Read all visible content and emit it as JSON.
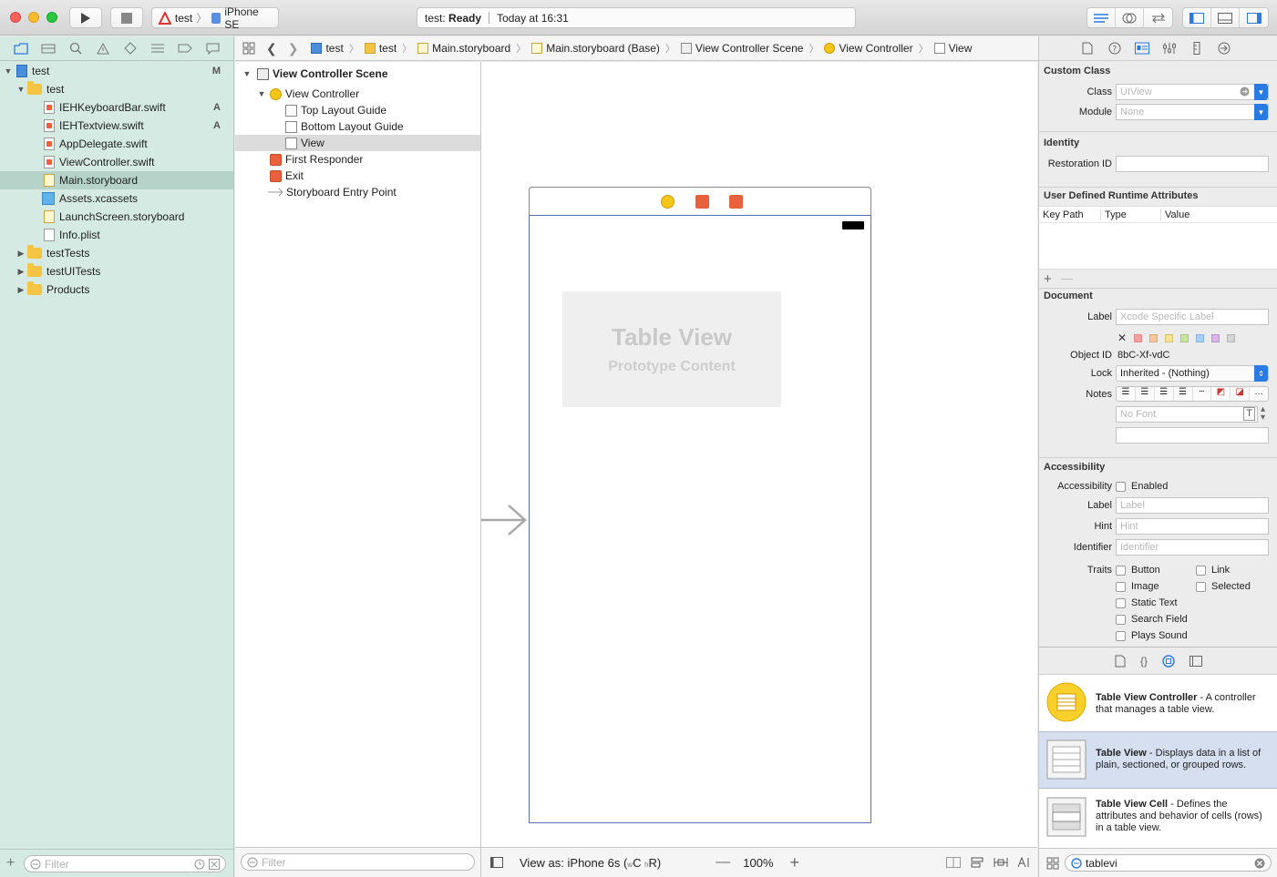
{
  "toolbar": {
    "scheme_target": "test",
    "scheme_device": "iPhone SE",
    "status_project": "test:",
    "status_state": "Ready",
    "status_time": "Today at 16:31"
  },
  "navigator": {
    "items": [
      {
        "label": "test",
        "badge": "M"
      },
      {
        "label": "test",
        "badge": ""
      },
      {
        "label": "IEHKeyboardBar.swift",
        "badge": "A"
      },
      {
        "label": "IEHTextview.swift",
        "badge": "A"
      },
      {
        "label": "AppDelegate.swift",
        "badge": ""
      },
      {
        "label": "ViewController.swift",
        "badge": ""
      },
      {
        "label": "Main.storyboard",
        "badge": ""
      },
      {
        "label": "Assets.xcassets",
        "badge": ""
      },
      {
        "label": "LaunchScreen.storyboard",
        "badge": ""
      },
      {
        "label": "Info.plist",
        "badge": ""
      },
      {
        "label": "testTests",
        "badge": ""
      },
      {
        "label": "testUITests",
        "badge": ""
      },
      {
        "label": "Products",
        "badge": ""
      }
    ],
    "filter_placeholder": "Filter"
  },
  "jumpbar": {
    "crumbs": [
      "test",
      "test",
      "Main.storyboard",
      "Main.storyboard (Base)",
      "View Controller Scene",
      "View Controller",
      "View"
    ]
  },
  "outline": {
    "items": [
      "View Controller Scene",
      "View Controller",
      "Top Layout Guide",
      "Bottom Layout Guide",
      "View",
      "First Responder",
      "Exit",
      "Storyboard Entry Point"
    ],
    "filter_placeholder": "Filter"
  },
  "canvas": {
    "tableview_title": "Table View",
    "tableview_subtitle": "Prototype Content",
    "view_as_prefix": "View as: iPhone 6s (",
    "size_w": "w",
    "size_wv": "C",
    "size_h": "h",
    "size_hv": "R",
    "view_as_suffix": ")",
    "zoom": "100%"
  },
  "inspector": {
    "custom_class": {
      "title": "Custom Class",
      "class_label": "Class",
      "class_placeholder": "UIView",
      "module_label": "Module",
      "module_placeholder": "None"
    },
    "identity": {
      "title": "Identity",
      "restoration_label": "Restoration ID"
    },
    "runtime": {
      "title": "User Defined Runtime Attributes",
      "col_keypath": "Key Path",
      "col_type": "Type",
      "col_value": "Value"
    },
    "document": {
      "title": "Document",
      "label_label": "Label",
      "label_placeholder": "Xcode Specific Label",
      "objectid_label": "Object ID",
      "objectid_value": "8bC-Xf-vdC",
      "lock_label": "Lock",
      "lock_value": "Inherited - (Nothing)",
      "notes_label": "Notes",
      "font_placeholder": "No Font"
    },
    "accessibility": {
      "title": "Accessibility",
      "access_label": "Accessibility",
      "enabled": "Enabled",
      "label_label": "Label",
      "label_placeholder": "Label",
      "hint_label": "Hint",
      "hint_placeholder": "Hint",
      "identifier_label": "Identifier",
      "identifier_placeholder": "Identifier",
      "traits_label": "Traits",
      "traits": [
        "Button",
        "Link",
        "Image",
        "Selected",
        "Static Text",
        "Search Field",
        "Plays Sound"
      ]
    }
  },
  "library": {
    "items": [
      {
        "name": "Table View Controller",
        "desc": " - A controller that manages a table view."
      },
      {
        "name": "Table View",
        "desc": " - Displays data in a list of plain, sectioned, or grouped rows."
      },
      {
        "name": "Table View Cell",
        "desc": " - Defines the attributes and behavior of cells (rows) in a table view."
      }
    ],
    "search_value": "tablevi"
  },
  "colors": {
    "navigator_bg": "#d4eae3",
    "accent": "#2a7ae4",
    "selection": "#b5d3c8"
  }
}
